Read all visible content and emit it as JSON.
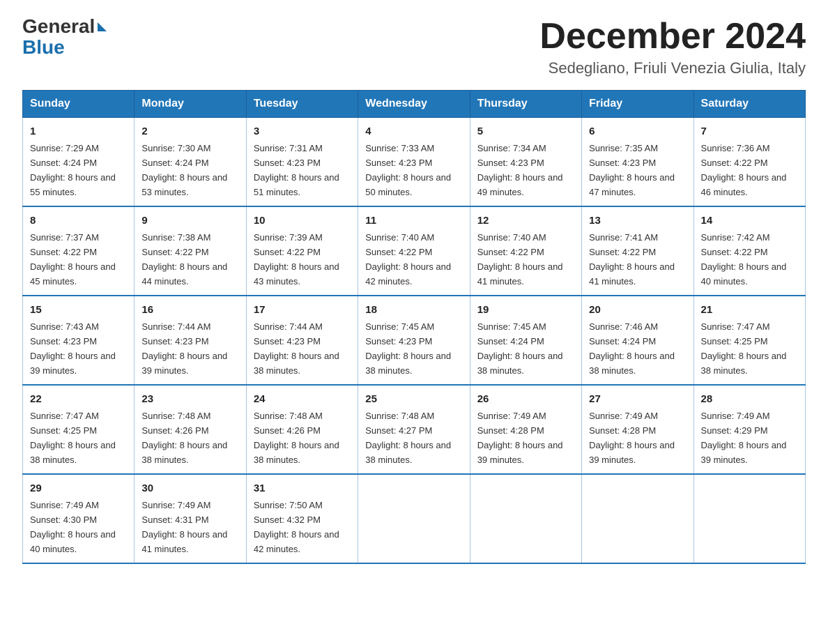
{
  "logo": {
    "general": "General",
    "blue": "Blue"
  },
  "title": "December 2024",
  "location": "Sedegliano, Friuli Venezia Giulia, Italy",
  "days_of_week": [
    "Sunday",
    "Monday",
    "Tuesday",
    "Wednesday",
    "Thursday",
    "Friday",
    "Saturday"
  ],
  "weeks": [
    [
      {
        "day": "1",
        "sunrise": "7:29 AM",
        "sunset": "4:24 PM",
        "daylight": "8 hours and 55 minutes."
      },
      {
        "day": "2",
        "sunrise": "7:30 AM",
        "sunset": "4:24 PM",
        "daylight": "8 hours and 53 minutes."
      },
      {
        "day": "3",
        "sunrise": "7:31 AM",
        "sunset": "4:23 PM",
        "daylight": "8 hours and 51 minutes."
      },
      {
        "day": "4",
        "sunrise": "7:33 AM",
        "sunset": "4:23 PM",
        "daylight": "8 hours and 50 minutes."
      },
      {
        "day": "5",
        "sunrise": "7:34 AM",
        "sunset": "4:23 PM",
        "daylight": "8 hours and 49 minutes."
      },
      {
        "day": "6",
        "sunrise": "7:35 AM",
        "sunset": "4:23 PM",
        "daylight": "8 hours and 47 minutes."
      },
      {
        "day": "7",
        "sunrise": "7:36 AM",
        "sunset": "4:22 PM",
        "daylight": "8 hours and 46 minutes."
      }
    ],
    [
      {
        "day": "8",
        "sunrise": "7:37 AM",
        "sunset": "4:22 PM",
        "daylight": "8 hours and 45 minutes."
      },
      {
        "day": "9",
        "sunrise": "7:38 AM",
        "sunset": "4:22 PM",
        "daylight": "8 hours and 44 minutes."
      },
      {
        "day": "10",
        "sunrise": "7:39 AM",
        "sunset": "4:22 PM",
        "daylight": "8 hours and 43 minutes."
      },
      {
        "day": "11",
        "sunrise": "7:40 AM",
        "sunset": "4:22 PM",
        "daylight": "8 hours and 42 minutes."
      },
      {
        "day": "12",
        "sunrise": "7:40 AM",
        "sunset": "4:22 PM",
        "daylight": "8 hours and 41 minutes."
      },
      {
        "day": "13",
        "sunrise": "7:41 AM",
        "sunset": "4:22 PM",
        "daylight": "8 hours and 41 minutes."
      },
      {
        "day": "14",
        "sunrise": "7:42 AM",
        "sunset": "4:22 PM",
        "daylight": "8 hours and 40 minutes."
      }
    ],
    [
      {
        "day": "15",
        "sunrise": "7:43 AM",
        "sunset": "4:23 PM",
        "daylight": "8 hours and 39 minutes."
      },
      {
        "day": "16",
        "sunrise": "7:44 AM",
        "sunset": "4:23 PM",
        "daylight": "8 hours and 39 minutes."
      },
      {
        "day": "17",
        "sunrise": "7:44 AM",
        "sunset": "4:23 PM",
        "daylight": "8 hours and 38 minutes."
      },
      {
        "day": "18",
        "sunrise": "7:45 AM",
        "sunset": "4:23 PM",
        "daylight": "8 hours and 38 minutes."
      },
      {
        "day": "19",
        "sunrise": "7:45 AM",
        "sunset": "4:24 PM",
        "daylight": "8 hours and 38 minutes."
      },
      {
        "day": "20",
        "sunrise": "7:46 AM",
        "sunset": "4:24 PM",
        "daylight": "8 hours and 38 minutes."
      },
      {
        "day": "21",
        "sunrise": "7:47 AM",
        "sunset": "4:25 PM",
        "daylight": "8 hours and 38 minutes."
      }
    ],
    [
      {
        "day": "22",
        "sunrise": "7:47 AM",
        "sunset": "4:25 PM",
        "daylight": "8 hours and 38 minutes."
      },
      {
        "day": "23",
        "sunrise": "7:48 AM",
        "sunset": "4:26 PM",
        "daylight": "8 hours and 38 minutes."
      },
      {
        "day": "24",
        "sunrise": "7:48 AM",
        "sunset": "4:26 PM",
        "daylight": "8 hours and 38 minutes."
      },
      {
        "day": "25",
        "sunrise": "7:48 AM",
        "sunset": "4:27 PM",
        "daylight": "8 hours and 38 minutes."
      },
      {
        "day": "26",
        "sunrise": "7:49 AM",
        "sunset": "4:28 PM",
        "daylight": "8 hours and 39 minutes."
      },
      {
        "day": "27",
        "sunrise": "7:49 AM",
        "sunset": "4:28 PM",
        "daylight": "8 hours and 39 minutes."
      },
      {
        "day": "28",
        "sunrise": "7:49 AM",
        "sunset": "4:29 PM",
        "daylight": "8 hours and 39 minutes."
      }
    ],
    [
      {
        "day": "29",
        "sunrise": "7:49 AM",
        "sunset": "4:30 PM",
        "daylight": "8 hours and 40 minutes."
      },
      {
        "day": "30",
        "sunrise": "7:49 AM",
        "sunset": "4:31 PM",
        "daylight": "8 hours and 41 minutes."
      },
      {
        "day": "31",
        "sunrise": "7:50 AM",
        "sunset": "4:32 PM",
        "daylight": "8 hours and 42 minutes."
      },
      null,
      null,
      null,
      null
    ]
  ]
}
